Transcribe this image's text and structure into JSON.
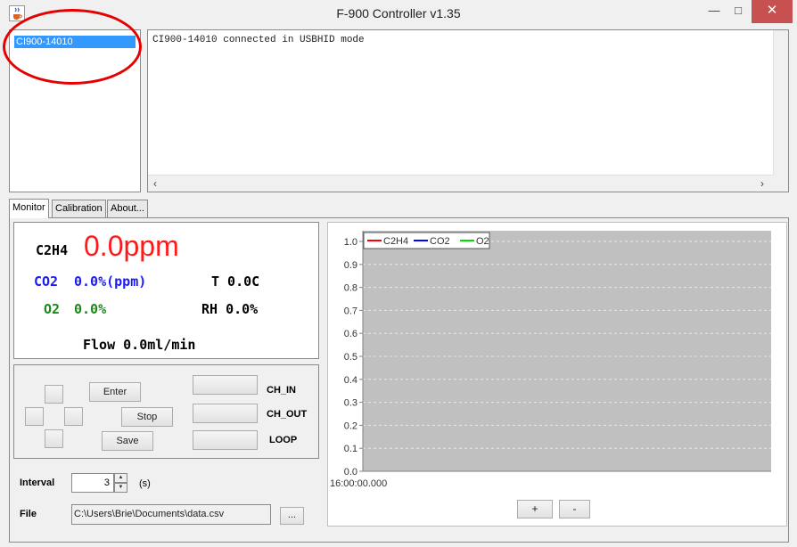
{
  "window": {
    "title": "F-900 Controller v1.35",
    "minimize": "—",
    "maximize": "□",
    "close": "✕"
  },
  "devices": {
    "items": [
      "CI900-14010"
    ],
    "selected": "CI900-14010"
  },
  "console": {
    "text": "CI900-14010 connected in USBHID mode",
    "scroll_left": "‹",
    "scroll_right": "›"
  },
  "tabs": [
    "Monitor",
    "Calibration",
    "About..."
  ],
  "active_tab": "Monitor",
  "readings": {
    "c2h4_label": "C2H4",
    "c2h4_value": "0.0ppm",
    "co2_label": "CO2",
    "co2_value": "0.0%(ppm)",
    "o2_label": "O2",
    "o2_value": "0.0%",
    "t_label": "T 0.0C",
    "rh_label": "RH 0.0%",
    "flow_label": "Flow 0.0ml/min"
  },
  "controls": {
    "enter": "Enter",
    "stop": "Stop",
    "save": "Save",
    "ch_in": "CH_IN",
    "ch_out": "CH_OUT",
    "loop": "LOOP"
  },
  "interval": {
    "label": "Interval",
    "value": "3",
    "unit": "(s)",
    "up": "▲",
    "down": "▼"
  },
  "file": {
    "label": "File",
    "path": "C:\\Users\\Brie\\Documents\\data.csv",
    "browse": "..."
  },
  "chart_data": {
    "type": "line",
    "series": [
      {
        "name": "C2H4",
        "color": "#ff0000",
        "values": []
      },
      {
        "name": "CO2",
        "color": "#0000ff",
        "values": []
      },
      {
        "name": "O2",
        "color": "#00dd00",
        "values": []
      }
    ],
    "x_tick_labels": [
      "16:00:00.000"
    ],
    "y_ticks": [
      "0.0",
      "0.1",
      "0.2",
      "0.3",
      "0.4",
      "0.5",
      "0.6",
      "0.7",
      "0.8",
      "0.9",
      "1.0"
    ],
    "ylim": [
      0.0,
      1.0
    ],
    "legend_position": "top-left",
    "plot_background": "#c0c0c0",
    "grid": true
  },
  "zoom": {
    "in": "+",
    "out": "-"
  }
}
